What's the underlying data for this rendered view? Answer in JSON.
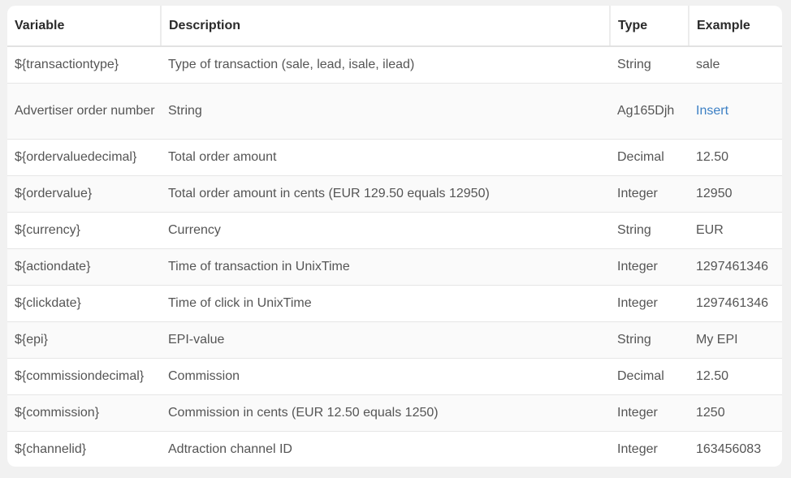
{
  "table": {
    "headers": [
      "Variable",
      "Description",
      "Type",
      "Example"
    ],
    "rows": [
      {
        "variable": "${transactiontype}",
        "description": "Type of transaction (sale, lead, isale, ilead)",
        "type": "String",
        "example": "sale"
      },
      {
        "variable": "Advertiser order number",
        "description": "String",
        "type": "Ag165Djh",
        "example": "Insert"
      },
      {
        "variable": "${ordervaluedecimal}",
        "description": "Total order amount",
        "type": "Decimal",
        "example": "12.50"
      },
      {
        "variable": "${ordervalue}",
        "description": "Total order amount in cents (EUR 129.50 equals 12950)",
        "type": "Integer",
        "example": "12950"
      },
      {
        "variable": "${currency}",
        "description": "Currency",
        "type": "String",
        "example": "EUR"
      },
      {
        "variable": "${actiondate}",
        "description": "Time of transaction in UnixTime",
        "type": "Integer",
        "example": "1297461346"
      },
      {
        "variable": "${clickdate}",
        "description": "Time of click in UnixTime",
        "type": "Integer",
        "example": "1297461346"
      },
      {
        "variable": "${epi}",
        "description": "EPI-value",
        "type": "String",
        "example": "My EPI"
      },
      {
        "variable": "${commissiondecimal}",
        "description": "Commission",
        "type": "Decimal",
        "example": "12.50"
      },
      {
        "variable": "${commission}",
        "description": "Commission in cents (EUR 12.50 equals 1250)",
        "type": "Integer",
        "example": "1250"
      },
      {
        "variable": "${channelid}",
        "description": "Adtraction channel ID",
        "type": "Integer",
        "example": "163456083"
      }
    ]
  },
  "colors": {
    "link": "#3b7fc4",
    "header_text": "#2a2a2a",
    "body_text": "#555555",
    "background": "#f1f1f1"
  }
}
